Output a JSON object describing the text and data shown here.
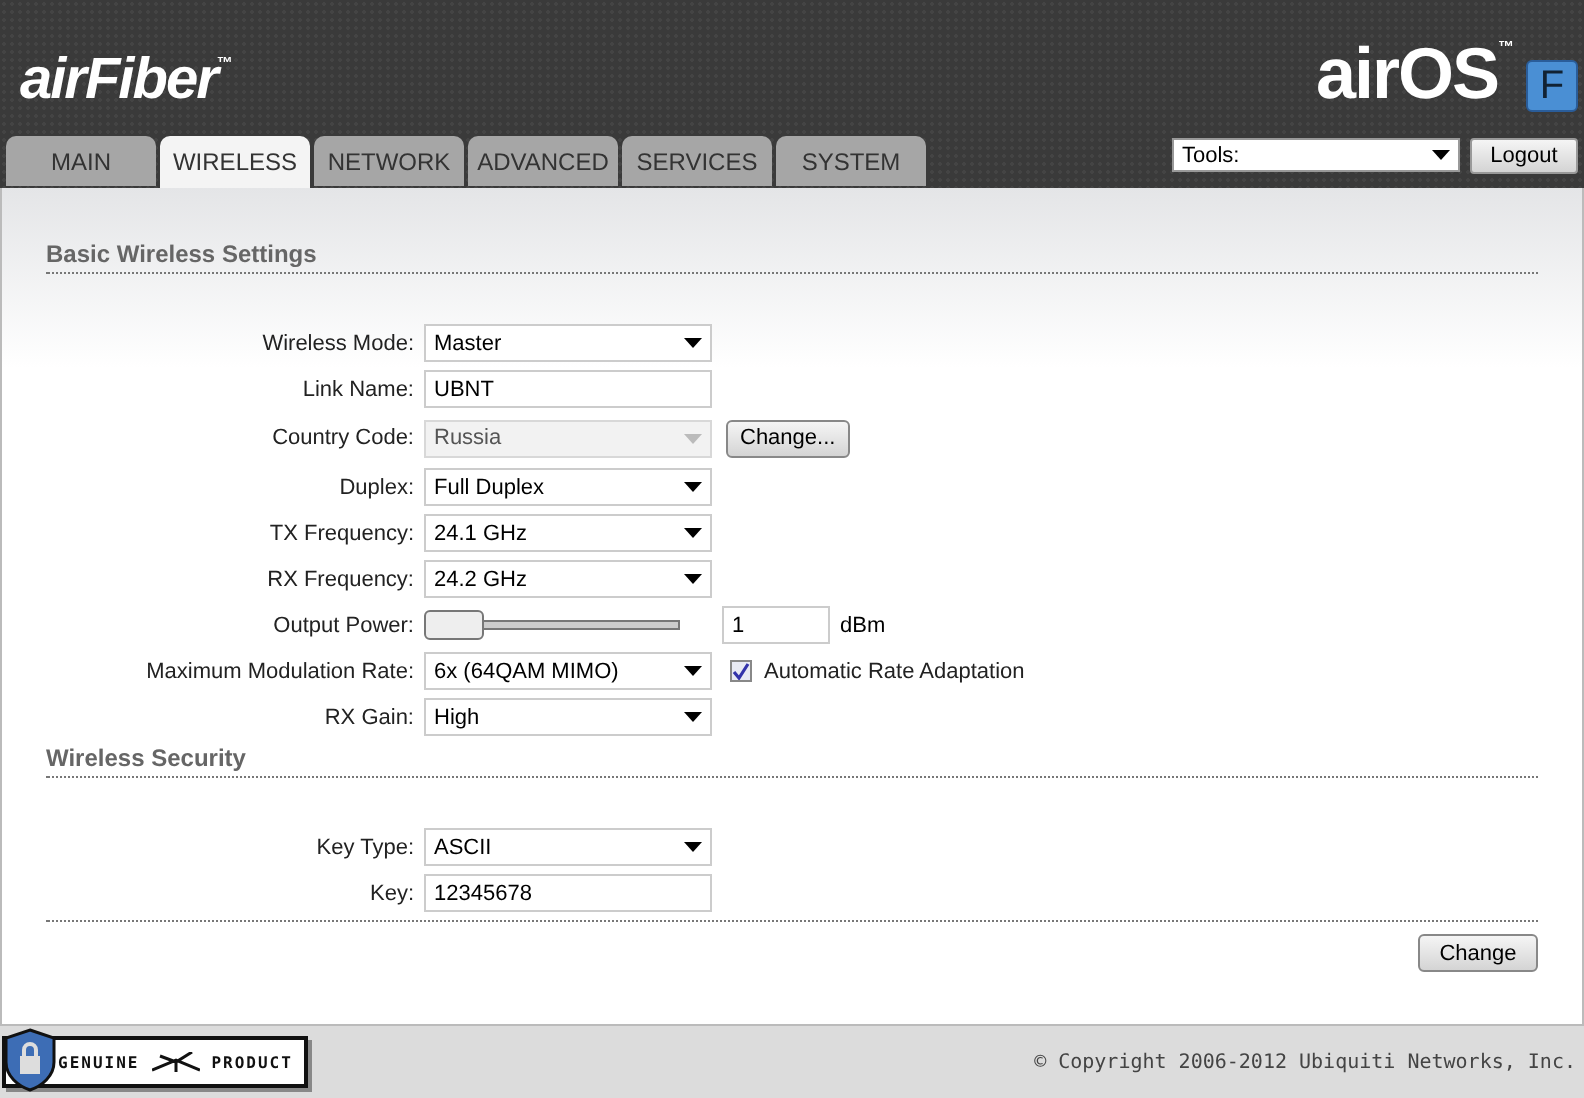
{
  "header": {
    "brand": "airFiber",
    "brand_mark": "™",
    "os_logo": "airOS",
    "os_mark": "™",
    "os_badge": "F"
  },
  "tabs": [
    {
      "label": "MAIN",
      "selected": false
    },
    {
      "label": "WIRELESS",
      "selected": true
    },
    {
      "label": "NETWORK",
      "selected": false
    },
    {
      "label": "ADVANCED",
      "selected": false
    },
    {
      "label": "SERVICES",
      "selected": false
    },
    {
      "label": "SYSTEM",
      "selected": false
    }
  ],
  "tools": {
    "value": "Tools:"
  },
  "logout_button": "Logout",
  "sections": [
    {
      "title": "Basic Wireless Settings",
      "rows": [
        {
          "kind": "select",
          "label": "Wireless Mode:",
          "value": "Master",
          "disabled": false
        },
        {
          "kind": "text",
          "label": "Link Name:",
          "value": "UBNT"
        },
        {
          "kind": "select",
          "label": "Country Code:",
          "value": "Russia",
          "disabled": true,
          "button": "Change..."
        },
        {
          "kind": "select",
          "label": "Duplex:",
          "value": "Full Duplex",
          "disabled": false
        },
        {
          "kind": "select",
          "label": "TX Frequency:",
          "value": "24.1 GHz",
          "disabled": false
        },
        {
          "kind": "select",
          "label": "RX Frequency:",
          "value": "24.2 GHz",
          "disabled": false
        },
        {
          "kind": "slider",
          "label": "Output Power:",
          "level": 0,
          "value": "1",
          "unit": "dBm"
        },
        {
          "kind": "select",
          "label": "Maximum Modulation Rate:",
          "value": "6x (64QAM MIMO)",
          "disabled": false,
          "checkbox": {
            "label": "Automatic Rate Adaptation",
            "checked": true
          }
        },
        {
          "kind": "select",
          "label": "RX Gain:",
          "value": "High",
          "disabled": false
        }
      ]
    },
    {
      "title": "Wireless Security",
      "rows": [
        {
          "kind": "select",
          "label": "Key Type:",
          "value": "ASCII",
          "disabled": false
        },
        {
          "kind": "text",
          "label": "Key:",
          "value": "12345678"
        }
      ]
    }
  ],
  "change_button": "Change",
  "footer": {
    "badge_left": "GENUINE",
    "badge_right": "PRODUCT",
    "copyright": "© Copyright 2006-2012 Ubiquiti Networks, Inc."
  }
}
